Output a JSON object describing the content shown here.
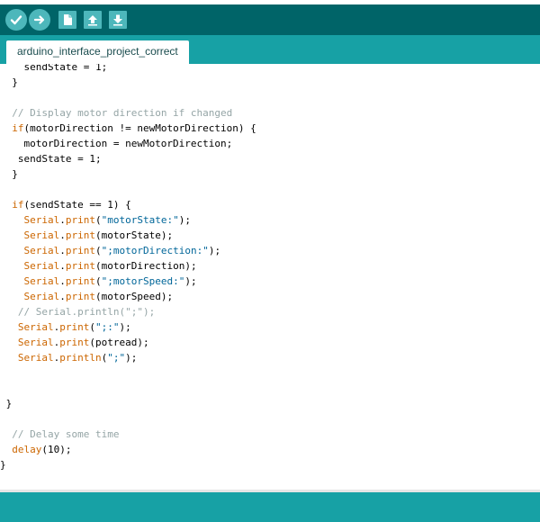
{
  "toolbar": {
    "buttons": [
      {
        "name": "verify",
        "icon": "checkmark-icon"
      },
      {
        "name": "upload",
        "icon": "arrow-right-icon"
      },
      {
        "name": "new",
        "icon": "new-file-icon"
      },
      {
        "name": "open",
        "icon": "open-arrow-up-icon"
      },
      {
        "name": "save",
        "icon": "save-arrow-down-icon"
      }
    ]
  },
  "tab": {
    "label": "arduino_interface_project_correct"
  },
  "code_lines": [
    {
      "text": "    sendState = 1;"
    },
    {
      "text": "  }"
    },
    {
      "text": ""
    },
    {
      "text": "  // Display motor direction if changed"
    },
    {
      "text": "  if(motorDirection != newMotorDirection) {"
    },
    {
      "text": "    motorDirection = newMotorDirection;"
    },
    {
      "text": "   sendState = 1;"
    },
    {
      "text": "  }"
    },
    {
      "text": ""
    },
    {
      "text": "  if(sendState == 1) {"
    },
    {
      "text": "    Serial.print(\"motorState:\");"
    },
    {
      "text": "    Serial.print(motorState);"
    },
    {
      "text": "    Serial.print(\";motorDirection:\");"
    },
    {
      "text": "    Serial.print(motorDirection);"
    },
    {
      "text": "    Serial.print(\";motorSpeed:\");"
    },
    {
      "text": "    Serial.print(motorSpeed);"
    },
    {
      "text": "   // Serial.println(\";\");"
    },
    {
      "text": "   Serial.print(\";:\");"
    },
    {
      "text": "   Serial.print(potread);"
    },
    {
      "text": "   Serial.println(\";\");"
    },
    {
      "text": ""
    },
    {
      "text": ""
    },
    {
      "text": " }"
    },
    {
      "text": ""
    },
    {
      "text": "  // Delay some time"
    },
    {
      "text": "  delay(10);"
    },
    {
      "text": "}"
    }
  ],
  "colors": {
    "toolbar_bg": "#006468",
    "tabbar_bg": "#17a1a5",
    "button_bg": "#4db7bb",
    "keyword": "#cc6600",
    "string": "#006699",
    "comment": "#95a5a6"
  }
}
